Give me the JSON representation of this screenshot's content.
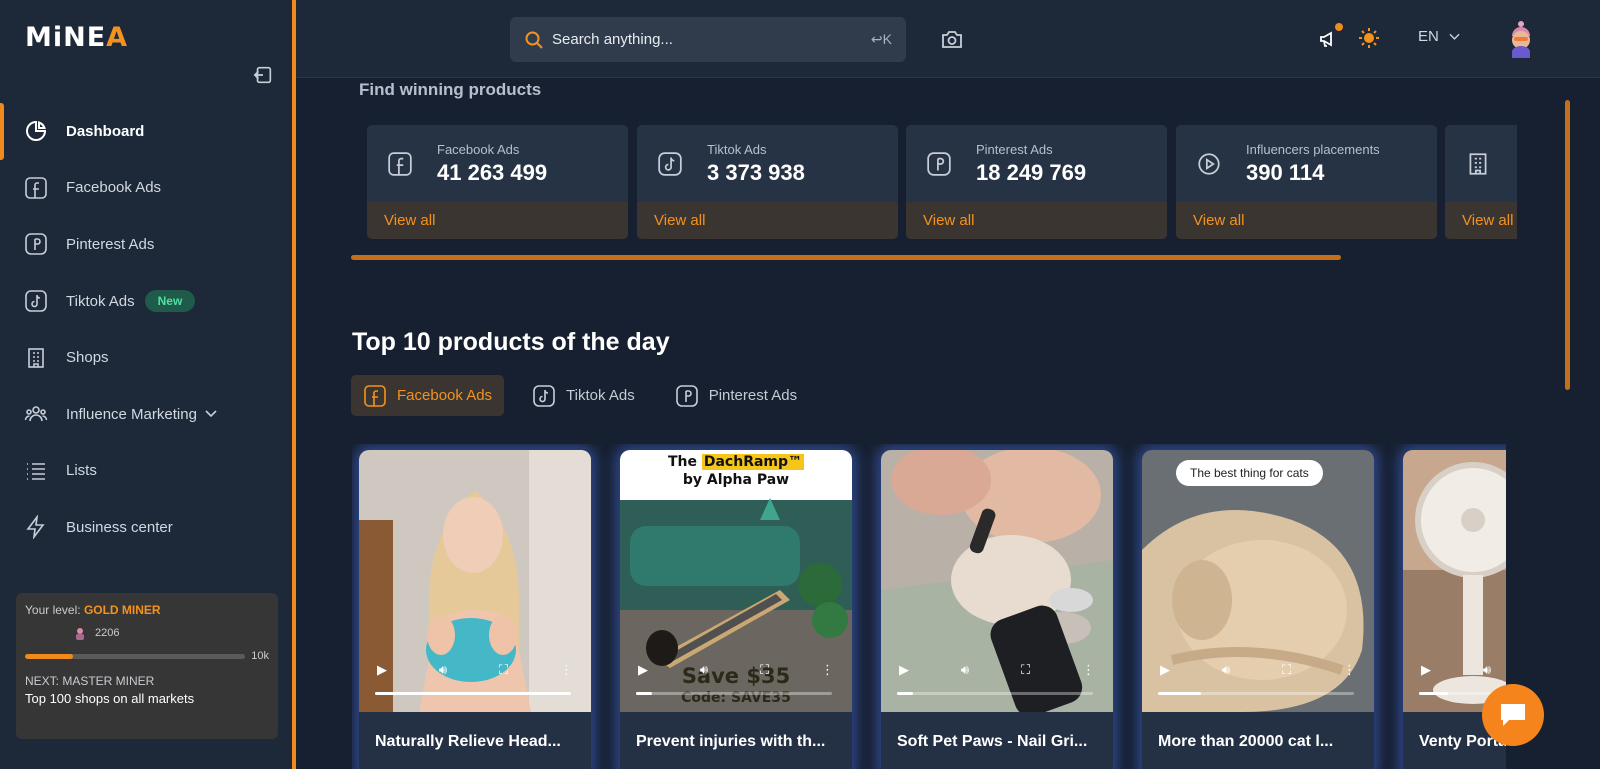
{
  "brand": {
    "logo_part1": "MiNE",
    "logo_part2": "A"
  },
  "sidebar": {
    "items": [
      {
        "label": "Dashboard",
        "icon": "pie-chart-icon"
      },
      {
        "label": "Facebook Ads",
        "icon": "facebook-icon"
      },
      {
        "label": "Pinterest Ads",
        "icon": "pinterest-icon"
      },
      {
        "label": "Tiktok Ads",
        "icon": "tiktok-icon",
        "badge": "New"
      },
      {
        "label": "Shops",
        "icon": "building-icon"
      },
      {
        "label": "Influence Marketing",
        "icon": "people-icon"
      },
      {
        "label": "Lists",
        "icon": "list-icon"
      },
      {
        "label": "Business center",
        "icon": "lightning-icon"
      }
    ],
    "level": {
      "label_prefix": "Your level: ",
      "level_name": "GOLD MINER",
      "points": "2206",
      "progress": 0.22,
      "max": "10k",
      "next": "NEXT: MASTER MINER",
      "next_desc": "Top 100 shops on all markets"
    }
  },
  "header": {
    "search_placeholder": "Search anything...",
    "search_shortcut": "↩K",
    "language": "EN"
  },
  "main": {
    "section_label": "Find winning products",
    "stats": [
      {
        "label": "Facebook Ads",
        "value": "41 263 499",
        "link": "View all",
        "icon": "facebook-icon"
      },
      {
        "label": "Tiktok Ads",
        "value": "3 373 938",
        "link": "View all",
        "icon": "tiktok-icon"
      },
      {
        "label": "Pinterest Ads",
        "value": "18 249 769",
        "link": "View all",
        "icon": "pinterest-icon"
      },
      {
        "label": "Influencers placements",
        "value": "390 114",
        "link": "View all",
        "icon": "play-circle-icon"
      },
      {
        "label": "",
        "value": "",
        "link": "View all",
        "icon": "building-icon"
      }
    ],
    "top_title": "Top 10 products of the day",
    "tabs": [
      {
        "label": "Facebook Ads",
        "active": true
      },
      {
        "label": "Tiktok Ads",
        "active": false
      },
      {
        "label": "Pinterest Ads",
        "active": false
      }
    ],
    "products": [
      {
        "title": "Naturally Relieve Head...",
        "progress": 1.0
      },
      {
        "title": "Prevent injuries with th...",
        "progress": 0.08,
        "overlay_line1": "The ",
        "overlay_brand": "DachRamp™",
        "overlay_line2": "by Alpha Paw",
        "promo": "Save $35",
        "promo_code": "Code: SAVE35"
      },
      {
        "title": "Soft Pet Paws - Nail Gri...",
        "progress": 0.08
      },
      {
        "title": "More than 20000 cat l...",
        "progress": 0.22,
        "overlay_tag": "The best thing for cats"
      },
      {
        "title": "Venty Porta",
        "progress": 0.15
      }
    ]
  }
}
